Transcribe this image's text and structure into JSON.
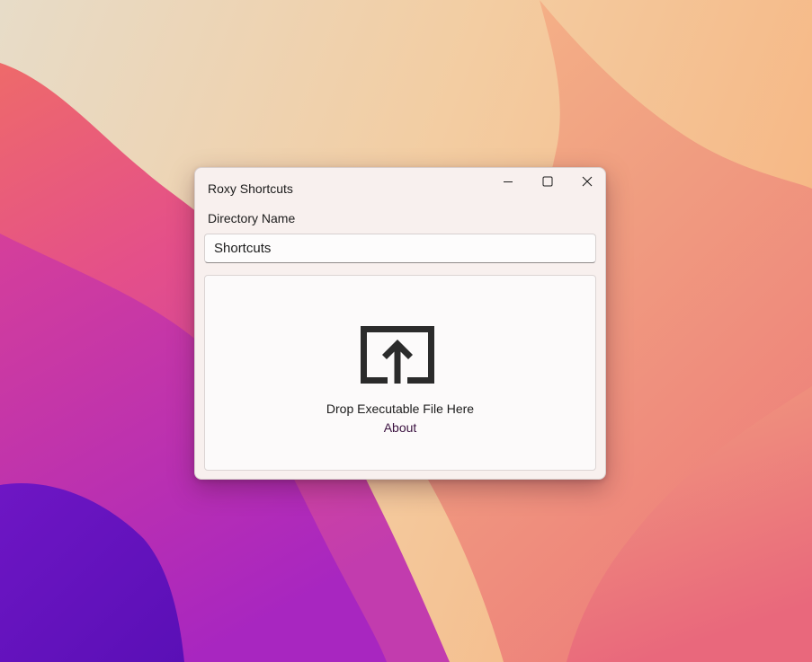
{
  "window": {
    "title": "Roxy Shortcuts",
    "controls": {
      "minimize_icon": "minimize-icon",
      "maximize_icon": "maximize-icon",
      "close_icon": "close-icon"
    }
  },
  "form": {
    "directory_label": "Directory Name",
    "directory_value": "Shortcuts"
  },
  "drop_zone": {
    "icon": "upload-icon",
    "text": "Drop Executable File Here",
    "about_label": "About"
  },
  "colors": {
    "window_bg": "#f8f0ee",
    "icon": "#2b2b2b",
    "link": "#3b1240"
  }
}
